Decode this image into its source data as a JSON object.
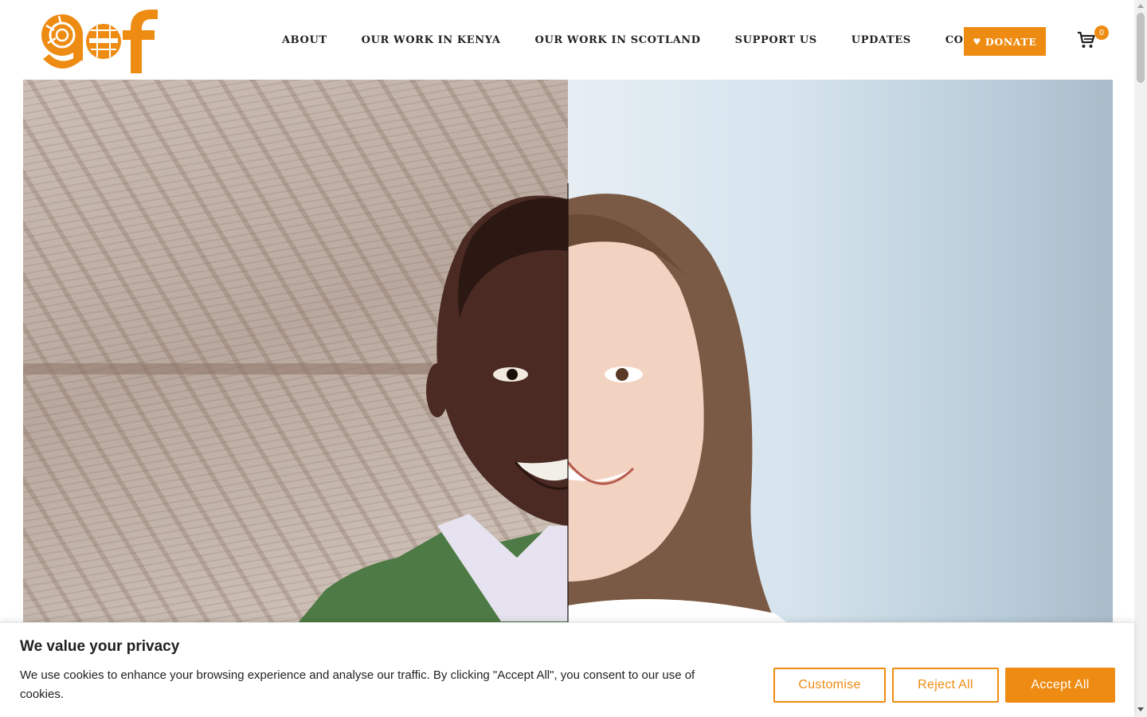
{
  "brand": {
    "logo_text": "gef",
    "accent_color": "#ee8b12"
  },
  "nav": {
    "items": [
      {
        "label": "ABOUT"
      },
      {
        "label": "OUR WORK IN KENYA"
      },
      {
        "label": "OUR WORK IN SCOTLAND"
      },
      {
        "label": "SUPPORT US"
      },
      {
        "label": "UPDATES"
      },
      {
        "label": "CONTACT"
      }
    ],
    "donate_label": "DONATE",
    "donate_icon": "heart-icon",
    "cart_icon": "cart-icon",
    "cart_count": "0"
  },
  "hero": {
    "image_description": ""
  },
  "cookie": {
    "title": "We value your privacy",
    "text": "We use cookies to enhance your browsing experience and analyse our traffic. By clicking \"Accept All\", you consent to our use of cookies.",
    "customise_label": "Customise",
    "reject_label": "Reject All",
    "accept_label": "Accept All"
  }
}
